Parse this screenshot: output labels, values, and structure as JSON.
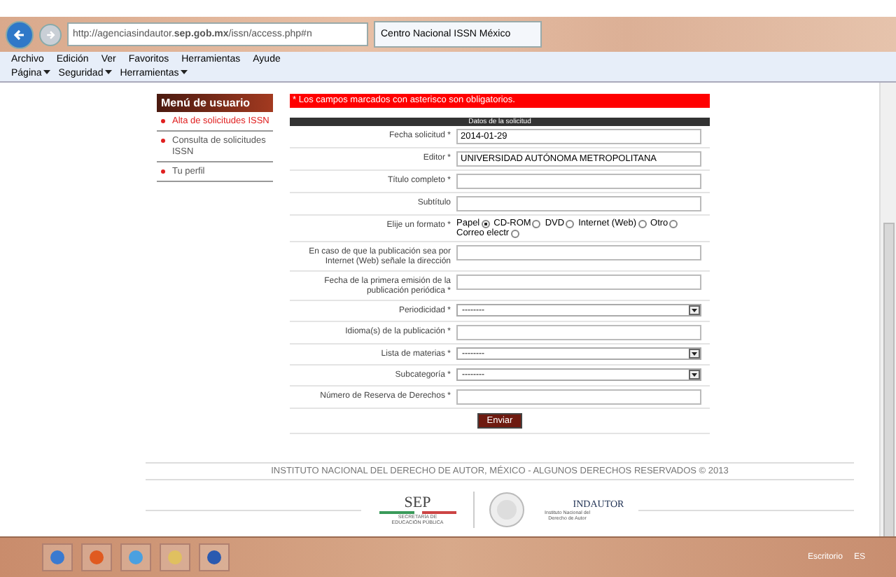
{
  "browser": {
    "url": "http://agenciasindautor.**sep.gob.mx**/issn/access.php#n",
    "tab_title": "Centro Nacional ISSN México",
    "menu": [
      "Archivo",
      "Edición",
      "Ver",
      "Favoritos",
      "Herramientas",
      "Ayude"
    ],
    "commands": [
      "Página",
      "Seguridad",
      "Herramientas"
    ]
  },
  "sidebar": {
    "title": "Menú de usuario",
    "items": [
      {
        "label": "Alta de solicitudes ISSN",
        "selected": true
      },
      {
        "label": "Consulta de solicitudes ISSN",
        "selected": false
      },
      {
        "label": "Tu perfil",
        "selected": false
      }
    ]
  },
  "notice": "* Los campos marcados con asterisco son obligatorios.",
  "form": {
    "title": "Datos de la solicitud",
    "rows": [
      {
        "kind": "text",
        "label": "Fecha solicitud *",
        "value": "2014-01-29"
      },
      {
        "kind": "text",
        "label": "Editor *",
        "value": "UNIVERSIDAD AUTÓNOMA METROPOLITANA"
      },
      {
        "kind": "text",
        "label": "Título completo *"
      },
      {
        "kind": "text",
        "label": "Subtítulo"
      },
      {
        "kind": "radio",
        "label": "Elije un formato *",
        "options": [
          {
            "label": "Papel",
            "selected": true
          },
          {
            "label": "CD-ROM",
            "selected": false
          },
          {
            "label": "DVD",
            "selected": false
          },
          {
            "label": "Internet (Web)",
            "selected": false
          },
          {
            "label": "Otro",
            "selected": false
          },
          {
            "label": "Correo electr",
            "selected": false
          }
        ]
      },
      {
        "kind": "text",
        "label": "En caso de que la publicación sea por Internet (Web) señale la dirección"
      },
      {
        "kind": "text",
        "label": "Fecha de la primera emisión de la publicación periódica *"
      },
      {
        "kind": "select",
        "label": "Periodicidad *",
        "value": "--------"
      },
      {
        "kind": "text",
        "label": "Idioma(s) de la publicación *"
      },
      {
        "kind": "select",
        "label": "Lista de materias *",
        "value": "--------"
      },
      {
        "kind": "select",
        "label": "Subcategoría *",
        "value": "--------"
      },
      {
        "kind": "text",
        "label": "Número de Reserva de Derechos *"
      }
    ],
    "submit": "Enviar"
  },
  "footer": {
    "copyright": "INSTITUTO NACIONAL DEL DERECHO DE AUTOR, MÉXICO - ALGUNOS DERECHOS RESERVADOS © 2013",
    "sep": "SEP",
    "sep_sub": "SECRETARÍA DE EDUCACIÓN PÚBLICA",
    "indautor": "INDAUTOR",
    "indautor_sub": "Instituto Nacional del Derecho de Autor"
  },
  "taskbar": {
    "desktop": "Escritorio",
    "language": "ES"
  }
}
